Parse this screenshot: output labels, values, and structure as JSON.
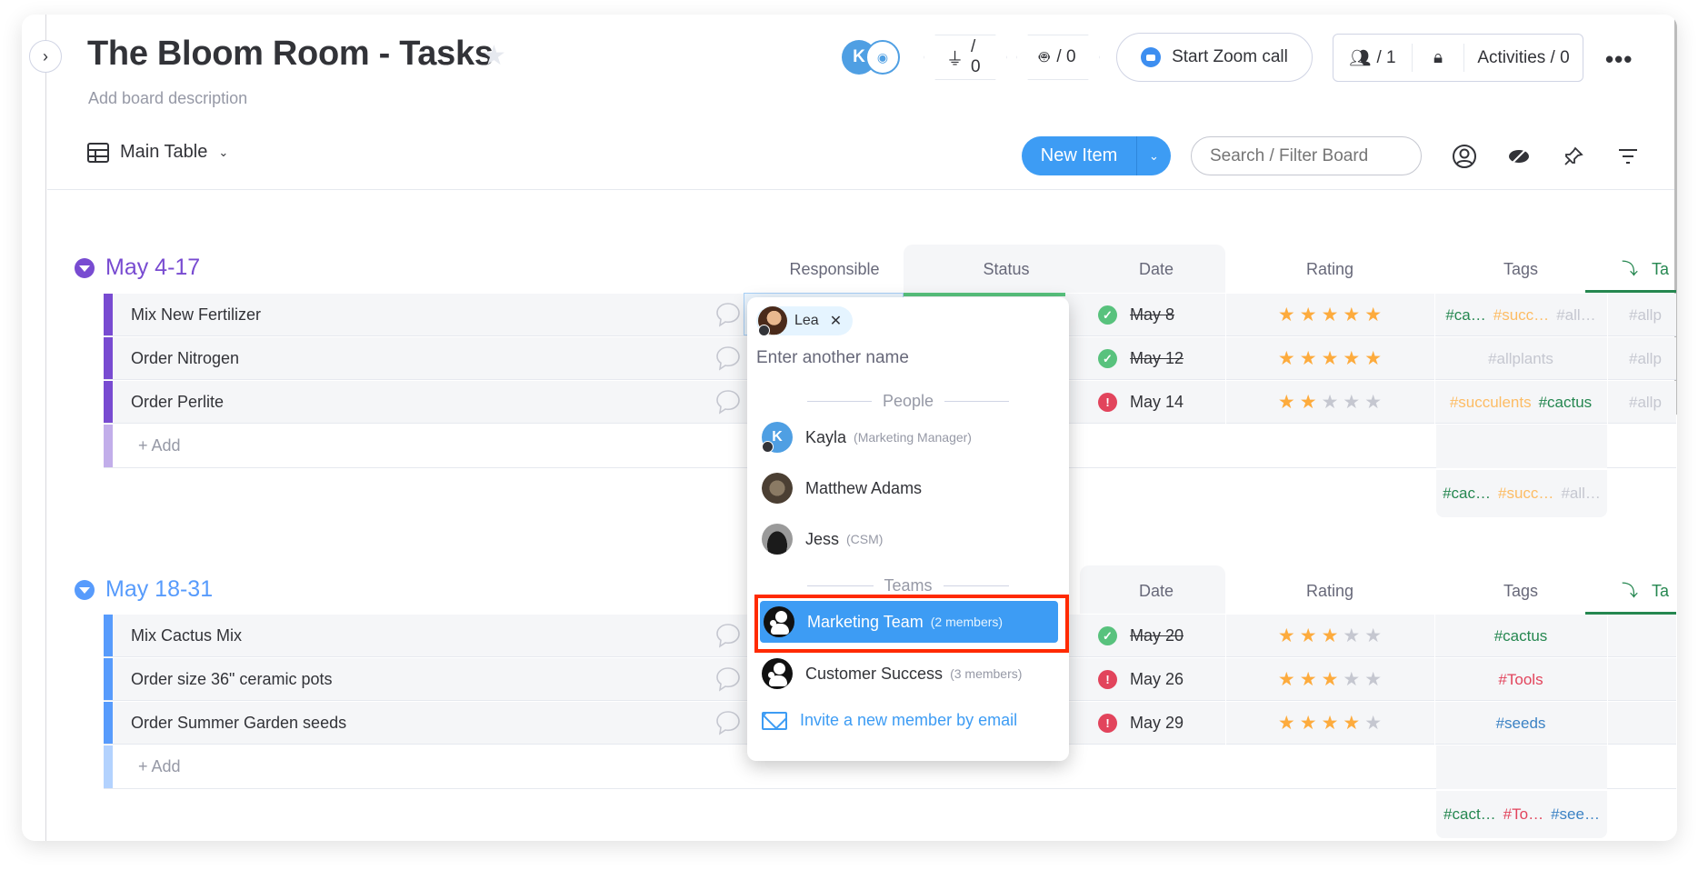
{
  "board": {
    "title": "The Bloom Room - Tasks",
    "description_placeholder": "Add board description",
    "view": "Main Table"
  },
  "header": {
    "integrations_count": "/ 0",
    "automations_count": "/ 0",
    "zoom_label": "Start Zoom call",
    "members_count": "/ 1",
    "activities_label": "Activities / 0",
    "avatar_initial": "K"
  },
  "toolbar": {
    "new_item_label": "New Item",
    "search_placeholder": "Search / Filter Board"
  },
  "columns": [
    "Responsible",
    "Status",
    "Date",
    "Rating",
    "Tags",
    "Ta"
  ],
  "groups": [
    {
      "title": "May 4-17",
      "color": "#784bd1",
      "add_label": "+ Add",
      "rows": [
        {
          "name": "Mix New Fertilizer",
          "status": "done",
          "date": "May 8",
          "rating": 5,
          "tags": [
            {
              "t": "#ca…",
              "c": "#258750"
            },
            {
              "t": "#succ…",
              "c": "#fdbc64"
            },
            {
              "t": "#all…",
              "c": "#c5c7d0"
            }
          ],
          "extra_tag": "#allp"
        },
        {
          "name": "Order Nitrogen",
          "status": "done",
          "date": "May 12",
          "rating": 5,
          "tags": [
            {
              "t": "#allplants",
              "c": "#c5c7d0"
            }
          ],
          "extra_tag": "#allp"
        },
        {
          "name": "Order Perlite",
          "status": "stuck",
          "date": "May 14",
          "rating": 2,
          "tags": [
            {
              "t": "#succulents",
              "c": "#fdbc64"
            },
            {
              "t": "#cactus",
              "c": "#258750"
            }
          ],
          "extra_tag": "#allp"
        }
      ],
      "summary_tags": [
        {
          "t": "#cac…",
          "c": "#258750"
        },
        {
          "t": "#succ…",
          "c": "#fdbc64"
        },
        {
          "t": "#all…",
          "c": "#c5c7d0"
        }
      ]
    },
    {
      "title": "May 18-31",
      "color": "#579bfc",
      "add_label": "+ Add",
      "rows": [
        {
          "name": "Mix Cactus Mix",
          "status": "done",
          "date": "May 20",
          "rating": 3,
          "tags": [
            {
              "t": "#cactus",
              "c": "#258750"
            }
          ],
          "extra_tag": ""
        },
        {
          "name": "Order size 36\" ceramic pots",
          "status": "stuck",
          "date": "May 26",
          "rating": 3,
          "tags": [
            {
              "t": "#Tools",
              "c": "#e2445c"
            }
          ],
          "extra_tag": ""
        },
        {
          "name": "Order Summer Garden seeds",
          "status": "stuck",
          "date": "May 29",
          "rating": 4,
          "tags": [
            {
              "t": "#seeds",
              "c": "#3b82c4"
            }
          ],
          "extra_tag": ""
        }
      ],
      "summary_tags": [
        {
          "t": "#cact…",
          "c": "#258750"
        },
        {
          "t": "#To…",
          "c": "#e2445c"
        },
        {
          "t": "#see…",
          "c": "#3b82c4"
        }
      ]
    }
  ],
  "people_picker": {
    "chip_name": "Lea",
    "input_placeholder": "Enter another name",
    "people_header": "People",
    "teams_header": "Teams",
    "people": [
      {
        "name": "Kayla",
        "sub": "(Marketing Manager)",
        "initial": "K"
      },
      {
        "name": "Matthew Adams",
        "sub": ""
      },
      {
        "name": "Jess",
        "sub": "(CSM)"
      }
    ],
    "teams": [
      {
        "name": "Marketing Team",
        "sub": "(2 members)",
        "selected": true
      },
      {
        "name": "Customer Success",
        "sub": "(3 members)",
        "selected": false
      }
    ],
    "invite_label": "Invite a new member by email"
  },
  "colors": {
    "primary": "#3d9cf4",
    "done": "#58c27d",
    "stuck": "#e2445c",
    "star_on": "#fdab3d",
    "star_off": "#c5c7d0",
    "highlight": "#ff2a00"
  }
}
